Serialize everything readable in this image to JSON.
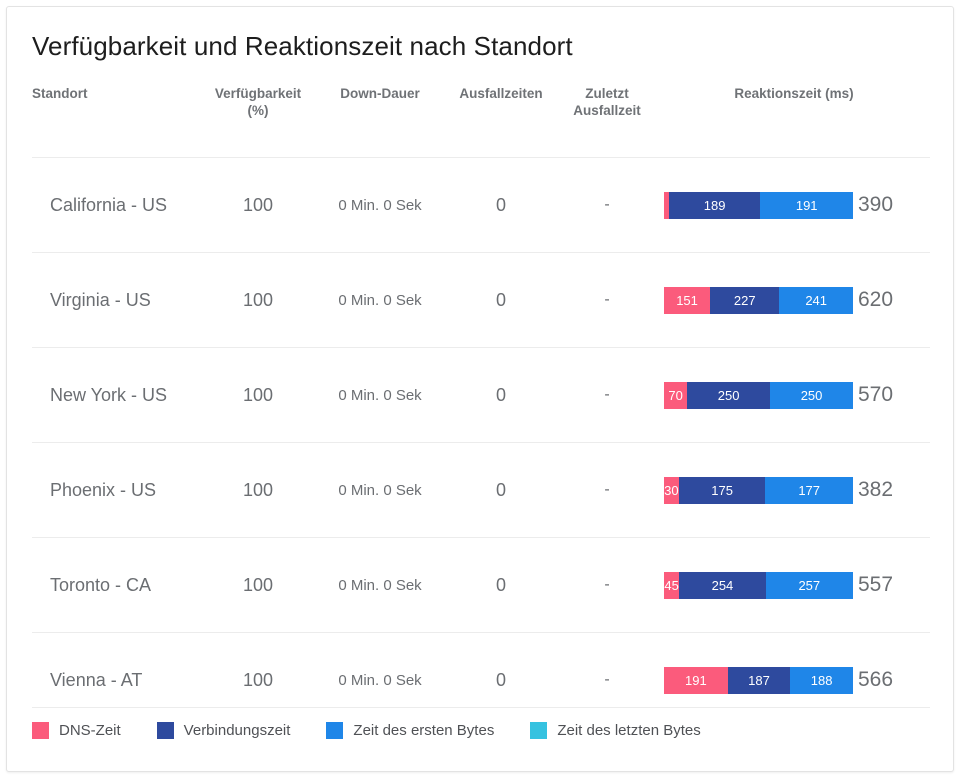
{
  "card": {
    "title": "Verfügbarkeit und Reaktionszeit nach Standort"
  },
  "table": {
    "headers": {
      "location": "Standort",
      "availability_line1": "Verfügbarkeit",
      "availability_line2": "(%)",
      "downtime_duration": "Down-Dauer",
      "outages": "Ausfallzeiten",
      "last_outage_line1": "Zuletzt",
      "last_outage_line2": "Ausfallzeit",
      "response_time": "Reaktionszeit (ms)"
    },
    "rows": [
      {
        "location": "California - US",
        "availability": "100",
        "downtime_duration": "0 Min. 0 Sek",
        "outages": "0",
        "last_outage": "-",
        "total": "390",
        "segments": [
          {
            "label": "10",
            "value": 10,
            "color": "#fb5b7c",
            "series": "DNS-Zeit",
            "show_label": false
          },
          {
            "label": "189",
            "value": 189,
            "color": "#2e4a9e",
            "series": "Verbindungszeit",
            "show_label": true
          },
          {
            "label": "191",
            "value": 191,
            "color": "#1f86e8",
            "series": "Zeit des ersten Bytes",
            "show_label": true
          }
        ]
      },
      {
        "location": "Virginia - US",
        "availability": "100",
        "downtime_duration": "0 Min. 0 Sek",
        "outages": "0",
        "last_outage": "-",
        "total": "620",
        "segments": [
          {
            "label": "151",
            "value": 151,
            "color": "#fb5b7c",
            "series": "DNS-Zeit",
            "show_label": true
          },
          {
            "label": "227",
            "value": 227,
            "color": "#2e4a9e",
            "series": "Verbindungszeit",
            "show_label": true
          },
          {
            "label": "241",
            "value": 241,
            "color": "#1f86e8",
            "series": "Zeit des ersten Bytes",
            "show_label": true
          }
        ]
      },
      {
        "location": "New York - US",
        "availability": "100",
        "downtime_duration": "0 Min. 0 Sek",
        "outages": "0",
        "last_outage": "-",
        "total": "570",
        "segments": [
          {
            "label": "70",
            "value": 70,
            "color": "#fb5b7c",
            "series": "DNS-Zeit",
            "show_label": true
          },
          {
            "label": "250",
            "value": 250,
            "color": "#2e4a9e",
            "series": "Verbindungszeit",
            "show_label": true
          },
          {
            "label": "250",
            "value": 250,
            "color": "#1f86e8",
            "series": "Zeit des ersten Bytes",
            "show_label": true
          }
        ]
      },
      {
        "location": "Phoenix - US",
        "availability": "100",
        "downtime_duration": "0 Min. 0 Sek",
        "outages": "0",
        "last_outage": "-",
        "total": "382",
        "segments": [
          {
            "label": "30",
            "value": 30,
            "color": "#fb5b7c",
            "series": "DNS-Zeit",
            "show_label": true
          },
          {
            "label": "175",
            "value": 175,
            "color": "#2e4a9e",
            "series": "Verbindungszeit",
            "show_label": true
          },
          {
            "label": "177",
            "value": 177,
            "color": "#1f86e8",
            "series": "Zeit des ersten Bytes",
            "show_label": true
          }
        ]
      },
      {
        "location": "Toronto - CA",
        "availability": "100",
        "downtime_duration": "0 Min. 0 Sek",
        "outages": "0",
        "last_outage": "-",
        "total": "557",
        "segments": [
          {
            "label": "45",
            "value": 45,
            "color": "#fb5b7c",
            "series": "DNS-Zeit",
            "show_label": true
          },
          {
            "label": "254",
            "value": 254,
            "color": "#2e4a9e",
            "series": "Verbindungszeit",
            "show_label": true
          },
          {
            "label": "257",
            "value": 257,
            "color": "#1f86e8",
            "series": "Zeit des ersten Bytes",
            "show_label": true
          }
        ]
      },
      {
        "location": "Vienna - AT",
        "availability": "100",
        "downtime_duration": "0 Min. 0 Sek",
        "outages": "0",
        "last_outage": "-",
        "total": "566",
        "segments": [
          {
            "label": "191",
            "value": 191,
            "color": "#fb5b7c",
            "series": "DNS-Zeit",
            "show_label": true
          },
          {
            "label": "187",
            "value": 187,
            "color": "#2e4a9e",
            "series": "Verbindungszeit",
            "show_label": true
          },
          {
            "label": "188",
            "value": 188,
            "color": "#1f86e8",
            "series": "Zeit des ersten Bytes",
            "show_label": true
          }
        ]
      }
    ]
  },
  "legend": {
    "items": [
      {
        "label": "DNS-Zeit",
        "color": "#fb5b7c"
      },
      {
        "label": "Verbindungszeit",
        "color": "#2e4a9e"
      },
      {
        "label": "Zeit des ersten Bytes",
        "color": "#1f86e8"
      },
      {
        "label": "Zeit des letzten Bytes",
        "color": "#35c2e0"
      }
    ]
  },
  "chart_data": {
    "type": "bar",
    "title": "Verfügbarkeit und Reaktionszeit nach Standort",
    "xlabel": "Reaktionszeit (ms)",
    "ylabel": "Standort",
    "stacked": true,
    "orientation": "horizontal",
    "grid": false,
    "legend_position": "bottom",
    "categories": [
      "California - US",
      "Virginia - US",
      "New York - US",
      "Phoenix - US",
      "Toronto - CA",
      "Vienna - AT"
    ],
    "series": [
      {
        "name": "DNS-Zeit",
        "color": "#fb5b7c",
        "values": [
          10,
          151,
          70,
          30,
          45,
          191
        ]
      },
      {
        "name": "Verbindungszeit",
        "color": "#2e4a9e",
        "values": [
          189,
          227,
          250,
          175,
          254,
          187
        ]
      },
      {
        "name": "Zeit des ersten Bytes",
        "color": "#1f86e8",
        "values": [
          191,
          241,
          250,
          177,
          257,
          188
        ]
      },
      {
        "name": "Zeit des letzten Bytes",
        "color": "#35c2e0",
        "values": [
          0,
          0,
          0,
          0,
          0,
          0
        ]
      }
    ],
    "totals": [
      390,
      620,
      570,
      382,
      557,
      566
    ],
    "availability_percent": [
      100,
      100,
      100,
      100,
      100,
      100
    ],
    "downtime_duration": [
      "0 Min. 0 Sek",
      "0 Min. 0 Sek",
      "0 Min. 0 Sek",
      "0 Min. 0 Sek",
      "0 Min. 0 Sek",
      "0 Min. 0 Sek"
    ],
    "outages": [
      0,
      0,
      0,
      0,
      0,
      0
    ],
    "last_outage": [
      "-",
      "-",
      "-",
      "-",
      "-",
      "-"
    ]
  }
}
